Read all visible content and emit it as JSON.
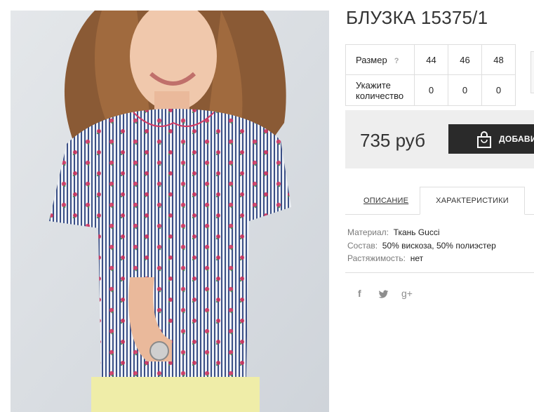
{
  "product": {
    "title": "БЛУЗКА 15375/1",
    "image_alt": "Model wearing striped floral blouse"
  },
  "sizes": {
    "size_label": "Размер",
    "help": "?",
    "options": [
      "44",
      "46",
      "48"
    ],
    "qty_label_line1": "Укажите",
    "qty_label_line2": "количество",
    "quantities": [
      "0",
      "0",
      "0"
    ]
  },
  "purchase": {
    "price": "735 руб",
    "button_label": "ДОБАВИТЬ"
  },
  "tabs": {
    "description": "ОПИСАНИЕ",
    "characteristics": "ХАРАКТЕРИСТИКИ"
  },
  "specs": [
    {
      "key": "Материал:",
      "value": "Ткань Gucci"
    },
    {
      "key": "Состав:",
      "value": "50% вискоза, 50% полиэстер"
    },
    {
      "key": "Растяжимость:",
      "value": "нет"
    }
  ],
  "social": {
    "facebook": "f",
    "twitter": "twitter-icon",
    "gplus": "g+"
  },
  "colors": {
    "button_bg": "#2a2a2a",
    "price_bg": "#eeeeee",
    "border": "#dedede"
  }
}
